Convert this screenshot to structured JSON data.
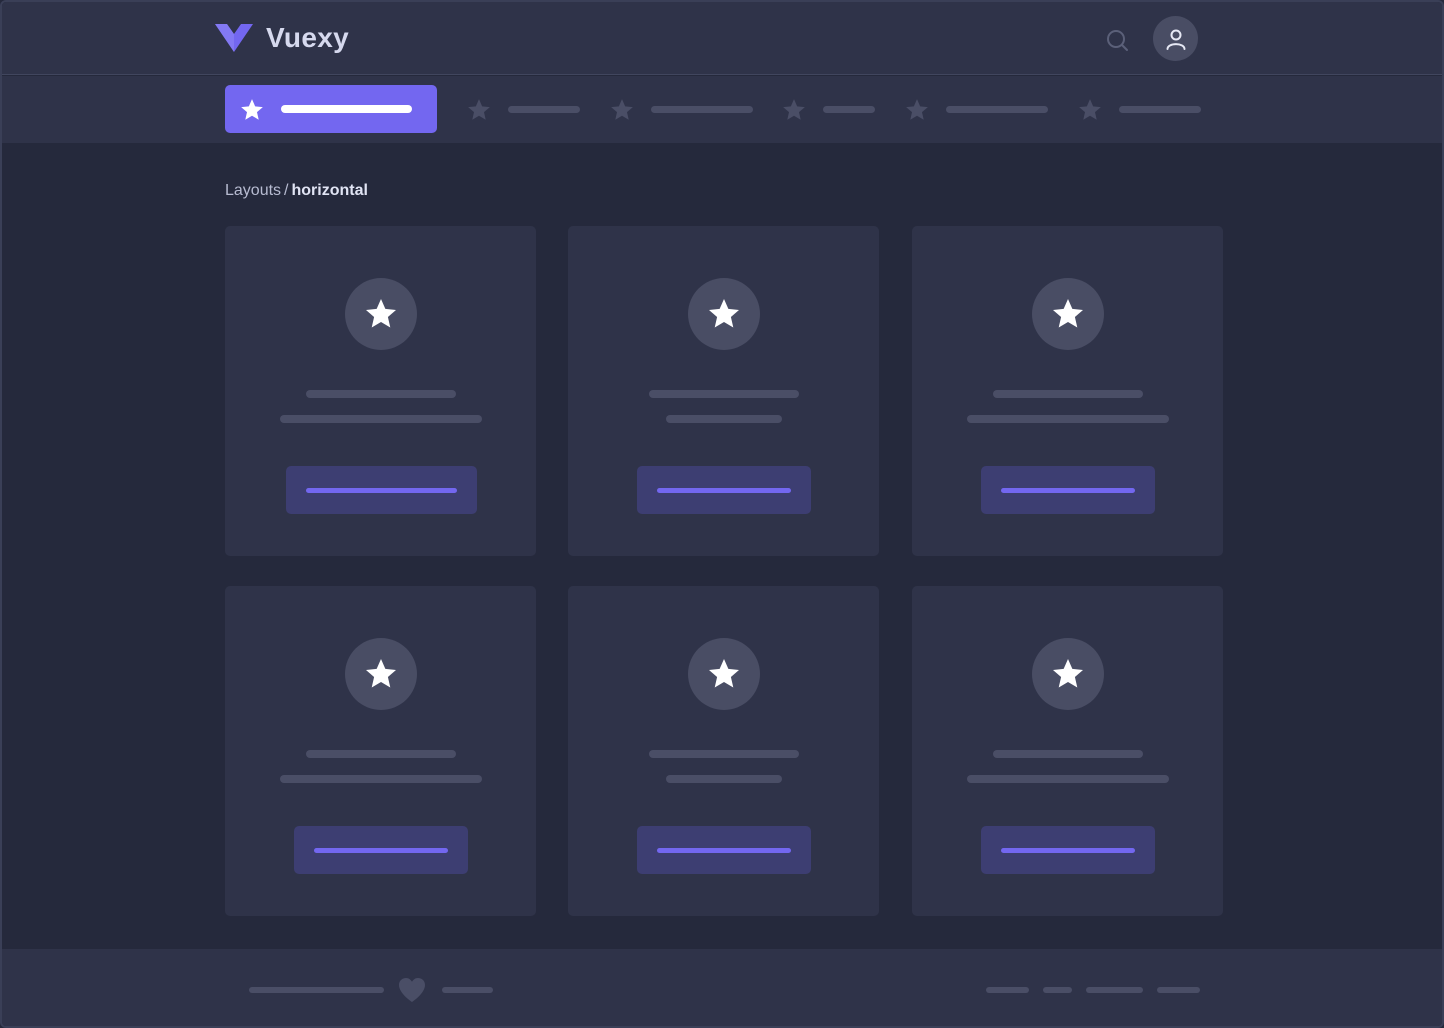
{
  "app": {
    "brand": "Vuexy"
  },
  "colors": {
    "background": "#25293c",
    "surface": "#2f3349",
    "accent": "#7367f0",
    "placeholder": "#4a4e66",
    "icon_circle": "#494d64",
    "button_fill": "#3d3e72"
  },
  "header": {
    "logo_icon": "vuexy-logo-icon",
    "search_icon": "search-icon",
    "user_icon": "user-icon"
  },
  "menu": {
    "items": [
      {
        "icon": "star-icon",
        "active": true
      },
      {
        "icon": "star-icon",
        "active": false
      },
      {
        "icon": "star-icon",
        "active": false
      },
      {
        "icon": "star-icon",
        "active": false
      },
      {
        "icon": "star-icon",
        "active": false
      },
      {
        "icon": "star-icon",
        "active": false
      }
    ]
  },
  "breadcrumb": {
    "parent": "Layouts",
    "separator": "/",
    "current": "horizontal"
  },
  "cards": [
    {
      "icon": "star-icon"
    },
    {
      "icon": "star-icon"
    },
    {
      "icon": "star-icon"
    },
    {
      "icon": "star-icon"
    },
    {
      "icon": "star-icon"
    },
    {
      "icon": "star-icon"
    }
  ],
  "footer": {
    "icon": "heart-icon"
  }
}
